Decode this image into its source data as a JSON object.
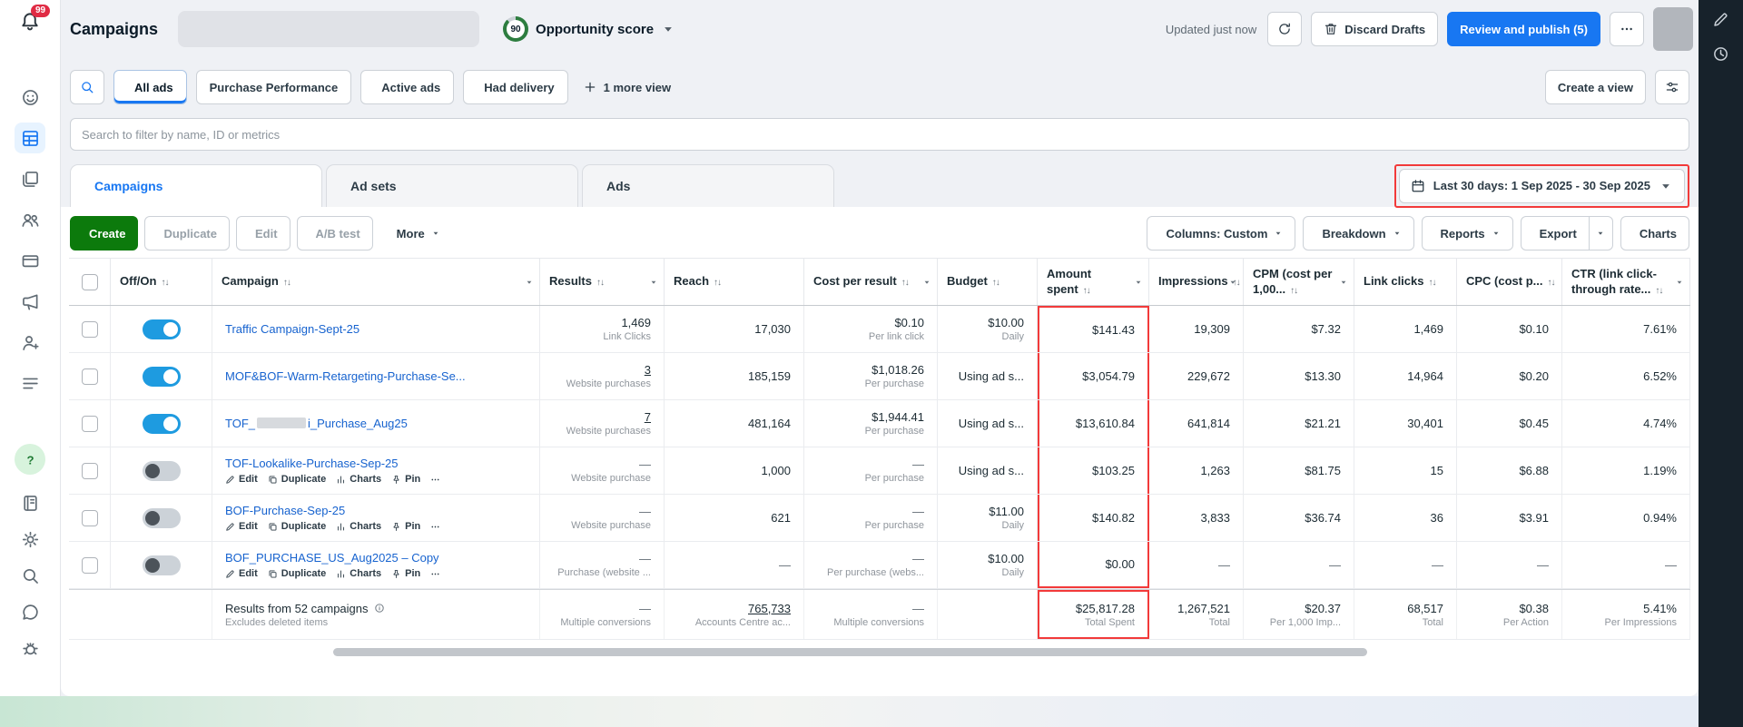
{
  "theme": {
    "accent_blue": "#1877f2",
    "create_green": "#0c7a0c",
    "link_blue": "#1763cf",
    "annotation_red": "#f23a3a",
    "toggle_on_blue": "#1e9be0",
    "dock_dark": "#17222b"
  },
  "header": {
    "title": "Campaigns",
    "opportunity_score_value": "90",
    "opportunity_score_label": "Opportunity score",
    "updated": "Updated just now",
    "discard_drafts": "Discard Drafts",
    "review_publish": "Review and publish (5)"
  },
  "sidebar": {
    "notification_badge": "99",
    "items": [
      {
        "icon": "smiley"
      },
      {
        "icon": "tablegrid",
        "active": true
      },
      {
        "icon": "layers"
      },
      {
        "icon": "people"
      },
      {
        "icon": "card"
      },
      {
        "icon": "megaphone"
      },
      {
        "icon": "personplus"
      },
      {
        "icon": "rows"
      }
    ],
    "bottom_items": [
      {
        "icon": "question",
        "style": "green"
      },
      {
        "icon": "notebook"
      },
      {
        "icon": "gear"
      },
      {
        "icon": "search"
      },
      {
        "icon": "chat"
      },
      {
        "icon": "bug"
      }
    ]
  },
  "dock": {
    "items": [
      {
        "icon": "pencil"
      },
      {
        "icon": "clock"
      }
    ]
  },
  "view_bar": {
    "tabs": [
      {
        "label": "All ads",
        "icon": "bookmark",
        "active": true
      },
      {
        "label": "Purchase Performance",
        "active": false
      },
      {
        "label": "Active ads",
        "icon": "bolt",
        "active": false
      },
      {
        "label": "Had delivery",
        "icon": "mail",
        "active": false
      }
    ],
    "more_view": "1 more view",
    "create_view": "Create a view"
  },
  "filter": {
    "placeholder": "Search to filter by name, ID or metrics"
  },
  "level_tabs": [
    {
      "label": "Campaigns",
      "icon": "bookmark",
      "active": true
    },
    {
      "label": "Ad sets",
      "icon": "grid4",
      "active": false
    },
    {
      "label": "Ads",
      "icon": "note",
      "active": false
    }
  ],
  "date_range": {
    "label": "Last 30 days: 1 Sep 2025 - 30 Sep 2025"
  },
  "toolbar": {
    "left": [
      {
        "label": "Create",
        "icon": "plus",
        "variant": "create"
      },
      {
        "label": "Duplicate",
        "icon": "copy",
        "variant": "dim"
      },
      {
        "label": "Edit",
        "icon": "pencil",
        "variant": "dim"
      },
      {
        "label": "A/B test",
        "icon": "flask",
        "variant": "dim"
      },
      {
        "label": "More",
        "variant": "plain",
        "caret": true
      }
    ],
    "right": [
      {
        "label": "Columns: Custom",
        "icon": "columns3",
        "caret": true
      },
      {
        "label": "Breakdown",
        "icon": "breakdown",
        "caret": true
      },
      {
        "label": "Reports",
        "icon": "reports",
        "caret": true
      },
      {
        "label": "Export",
        "icon": "export",
        "split": true
      },
      {
        "label": "Charts",
        "icon": "chart"
      }
    ]
  },
  "row_actions": [
    {
      "label": "Edit",
      "icon": "pencil"
    },
    {
      "label": "Duplicate",
      "icon": "copy"
    },
    {
      "label": "Charts",
      "icon": "bars"
    },
    {
      "label": "Pin",
      "icon": "pin"
    }
  ],
  "table": {
    "columns": [
      {
        "label": "Off/On",
        "sort": true
      },
      {
        "label": "Campaign",
        "sort": true,
        "caret": true
      },
      {
        "label": "Results",
        "sort": true,
        "caret": true
      },
      {
        "label": "Reach",
        "sort": true
      },
      {
        "label": "Cost per result",
        "sort": true,
        "caret": true
      },
      {
        "label": "Budget",
        "sort": true
      },
      {
        "label": "Amount spent",
        "sort": true,
        "caret": true
      },
      {
        "label": "Impressions",
        "sort": true,
        "caret": true
      },
      {
        "label": "CPM (cost per 1,00...",
        "sort": true,
        "caret": true
      },
      {
        "label": "Link clicks",
        "sort": true
      },
      {
        "label": "CPC (cost p...",
        "sort": true
      },
      {
        "label": "CTR (link click-through rate...",
        "sort": true,
        "caret": true
      }
    ],
    "rows": [
      {
        "toggle": true,
        "name": "Traffic Campaign-Sept-25",
        "metrics": [
          {
            "v": "1,469",
            "sub": "Link Clicks"
          },
          {
            "v": "17,030"
          },
          {
            "v": "$0.10",
            "sub": "Per link click"
          },
          {
            "v": "$10.00",
            "sub": "Daily"
          },
          {
            "v": "$141.43"
          },
          {
            "v": "19,309"
          },
          {
            "v": "$7.32"
          },
          {
            "v": "1,469"
          },
          {
            "v": "$0.10"
          },
          {
            "v": "7.61%"
          }
        ]
      },
      {
        "toggle": true,
        "name": "MOF&BOF-Warm-Retargeting-Purchase-Se...",
        "metrics": [
          {
            "v": "3",
            "sub": "Website purchases",
            "u": true
          },
          {
            "v": "185,159"
          },
          {
            "v": "$1,018.26",
            "sub": "Per purchase"
          },
          {
            "v": "Using ad s..."
          },
          {
            "v": "$3,054.79"
          },
          {
            "v": "229,672"
          },
          {
            "v": "$13.30"
          },
          {
            "v": "14,964"
          },
          {
            "v": "$0.20"
          },
          {
            "v": "6.52%"
          }
        ]
      },
      {
        "toggle": true,
        "redacted": true,
        "name_prefix": "TOF_",
        "name_suffix": "i_Purchase_Aug25",
        "metrics": [
          {
            "v": "7",
            "sub": "Website purchases",
            "u": true
          },
          {
            "v": "481,164"
          },
          {
            "v": "$1,944.41",
            "sub": "Per purchase"
          },
          {
            "v": "Using ad s..."
          },
          {
            "v": "$13,610.84"
          },
          {
            "v": "641,814"
          },
          {
            "v": "$21.21"
          },
          {
            "v": "30,401"
          },
          {
            "v": "$0.45"
          },
          {
            "v": "4.74%"
          }
        ]
      },
      {
        "toggle": false,
        "name": "TOF-Lookalike-Purchase-Sep-25",
        "actions": true,
        "metrics": [
          {
            "v": "—",
            "sub": "Website purchase"
          },
          {
            "v": "1,000"
          },
          {
            "v": "—",
            "sub": "Per purchase"
          },
          {
            "v": "Using ad s..."
          },
          {
            "v": "$103.25"
          },
          {
            "v": "1,263"
          },
          {
            "v": "$81.75"
          },
          {
            "v": "15"
          },
          {
            "v": "$6.88"
          },
          {
            "v": "1.19%"
          }
        ]
      },
      {
        "toggle": false,
        "name": "BOF-Purchase-Sep-25",
        "actions": true,
        "metrics": [
          {
            "v": "—",
            "sub": "Website purchase"
          },
          {
            "v": "621"
          },
          {
            "v": "—",
            "sub": "Per purchase"
          },
          {
            "v": "$11.00",
            "sub": "Daily"
          },
          {
            "v": "$140.82"
          },
          {
            "v": "3,833"
          },
          {
            "v": "$36.74"
          },
          {
            "v": "36"
          },
          {
            "v": "$3.91"
          },
          {
            "v": "0.94%"
          }
        ]
      },
      {
        "toggle": false,
        "name": "BOF_PURCHASE_US_Aug2025 – Copy",
        "actions": true,
        "metrics": [
          {
            "v": "—",
            "sub": "Purchase (website ..."
          },
          {
            "v": "—"
          },
          {
            "v": "—",
            "sub": "Per purchase (webs..."
          },
          {
            "v": "$10.00",
            "sub": "Daily"
          },
          {
            "v": "$0.00"
          },
          {
            "v": "—"
          },
          {
            "v": "—"
          },
          {
            "v": "—"
          },
          {
            "v": "—"
          },
          {
            "v": "—"
          }
        ]
      }
    ],
    "footer": {
      "title": "Results from 52 campaigns",
      "subtitle": "Excludes deleted items",
      "metrics": [
        {
          "v": "—",
          "sub": "Multiple conversions"
        },
        {
          "v": "765,733",
          "sub": "Accounts Centre ac...",
          "u": true
        },
        {
          "v": "—",
          "sub": "Multiple conversions"
        },
        {
          "v": ""
        },
        {
          "v": "$25,817.28",
          "sub": "Total Spent"
        },
        {
          "v": "1,267,521",
          "sub": "Total"
        },
        {
          "v": "$20.37",
          "sub": "Per 1,000 Imp..."
        },
        {
          "v": "68,517",
          "sub": "Total"
        },
        {
          "v": "$0.38",
          "sub": "Per Action"
        },
        {
          "v": "5.41%",
          "sub": "Per Impressions"
        }
      ]
    }
  }
}
